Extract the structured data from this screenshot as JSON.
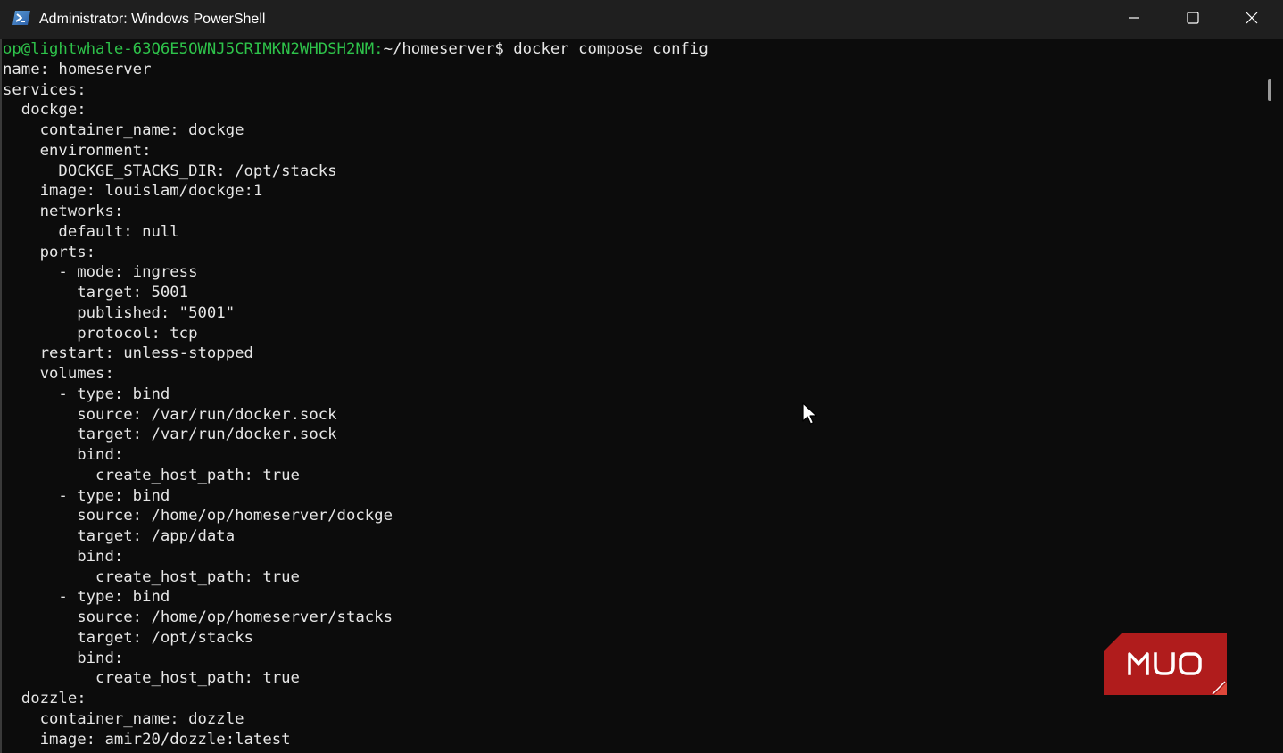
{
  "window": {
    "title": "Administrator: Windows PowerShell",
    "icon": "powershell-icon",
    "controls": {
      "minimize": "minimize-icon",
      "maximize": "maximize-icon",
      "close": "close-icon"
    }
  },
  "terminal": {
    "prompt": {
      "user_host": "op@lightwhale-63Q6E5OWNJ5CRIMKN2WHDSH2NM:",
      "path": "~/homeserver$",
      "command": " docker compose config"
    },
    "lines": [
      "name: homeserver",
      "services:",
      "  dockge:",
      "    container_name: dockge",
      "    environment:",
      "      DOCKGE_STACKS_DIR: /opt/stacks",
      "    image: louislam/dockge:1",
      "    networks:",
      "      default: null",
      "    ports:",
      "      - mode: ingress",
      "        target: 5001",
      "        published: \"5001\"",
      "        protocol: tcp",
      "    restart: unless-stopped",
      "    volumes:",
      "      - type: bind",
      "        source: /var/run/docker.sock",
      "        target: /var/run/docker.sock",
      "        bind:",
      "          create_host_path: true",
      "      - type: bind",
      "        source: /home/op/homeserver/dockge",
      "        target: /app/data",
      "        bind:",
      "          create_host_path: true",
      "      - type: bind",
      "        source: /home/op/homeserver/stacks",
      "        target: /opt/stacks",
      "        bind:",
      "          create_host_path: true",
      "  dozzle:",
      "    container_name: dozzle",
      "    image: amir20/dozzle:latest"
    ]
  },
  "watermark": {
    "text": "MUO",
    "color": "#b01c1c"
  },
  "colors": {
    "background": "#0c0c0c",
    "titlebar": "#1f1f1f",
    "prompt_user": "#2ec24a",
    "text": "#e6e6e6"
  }
}
